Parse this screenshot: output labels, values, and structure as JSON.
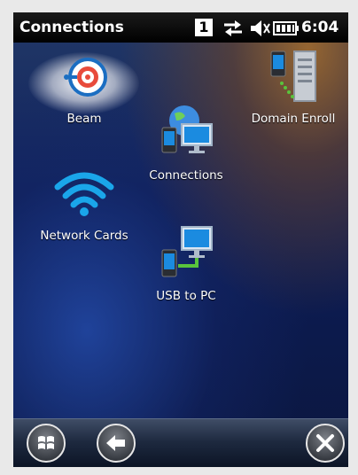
{
  "status_bar": {
    "title": "Connections",
    "badge": "1",
    "time": "6:04",
    "icons": [
      "connectivity-arrows-icon",
      "speaker-muted-icon",
      "battery-icon"
    ]
  },
  "apps": [
    {
      "label": "Beam",
      "icon": "beam-target-icon",
      "selected": true
    },
    {
      "label": "Connections",
      "icon": "globe-device-monitor-icon"
    },
    {
      "label": "Domain Enroll",
      "icon": "device-server-icon"
    },
    {
      "label": "Network Cards",
      "icon": "wifi-icon"
    },
    {
      "label": "USB to PC",
      "icon": "usb-device-monitor-icon"
    }
  ],
  "taskbar": {
    "buttons": [
      "windows-start-icon",
      "back-arrow-icon",
      "close-icon"
    ]
  }
}
